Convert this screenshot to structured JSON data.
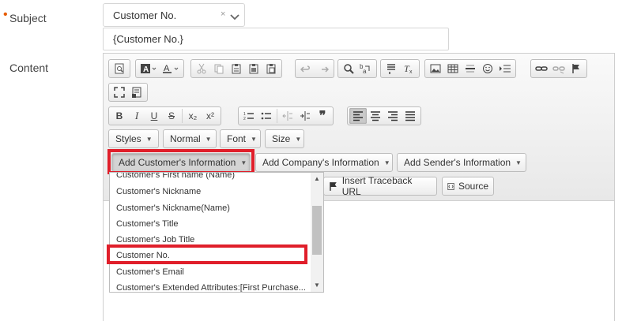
{
  "form": {
    "subject_label": "Subject",
    "required_marker": "•",
    "content_label": "Content",
    "subject_select_value": "Customer No.",
    "subject_select_clear": "×",
    "subject_input_value": "{Customer No.}"
  },
  "toolbar": {
    "row1_icons": [
      "preview-icon",
      "text-color-icon",
      "bg-color-icon",
      "cut-icon",
      "copy-icon",
      "paste-icon",
      "paste-text-icon",
      "paste-word-icon",
      "undo-icon",
      "redo-icon",
      "find-icon",
      "replace-icon",
      "insert-block-icon",
      "remove-format-icon",
      "image-icon",
      "table-icon",
      "horizontal-rule-icon",
      "smiley-icon",
      "indent-icon",
      "link-icon",
      "unlink-icon",
      "anchor-icon"
    ],
    "row2_icons": [
      "maximize-icon",
      "show-blocks-icon"
    ],
    "bold": "B",
    "italic": "I",
    "underline": "U",
    "strike": "S",
    "subscript": "x₂",
    "superscript": "x²",
    "blockquote": "❞",
    "styles_label": "Styles",
    "format_label": "Normal",
    "font_label": "Font",
    "size_label": "Size",
    "add_customer_info": "Add Customer's Information",
    "add_company_info": "Add Company's Information",
    "add_sender_info": "Add Sender's Information",
    "insert_traceback_url": "Insert Traceback URL",
    "source_label": "Source"
  },
  "dropdown": {
    "items": [
      "Customer's First name (Name)",
      "Customer's Nickname",
      "Customer's Nickname(Name)",
      "Customer's Title",
      "Customer's Job Title",
      "Customer No.",
      "Customer's Email",
      "Customer's Extended Attributes:[First Purchase..."
    ],
    "highlighted_item": "Customer No."
  },
  "colors": {
    "highlight": "#e01e2a",
    "required": "#e65c00"
  }
}
